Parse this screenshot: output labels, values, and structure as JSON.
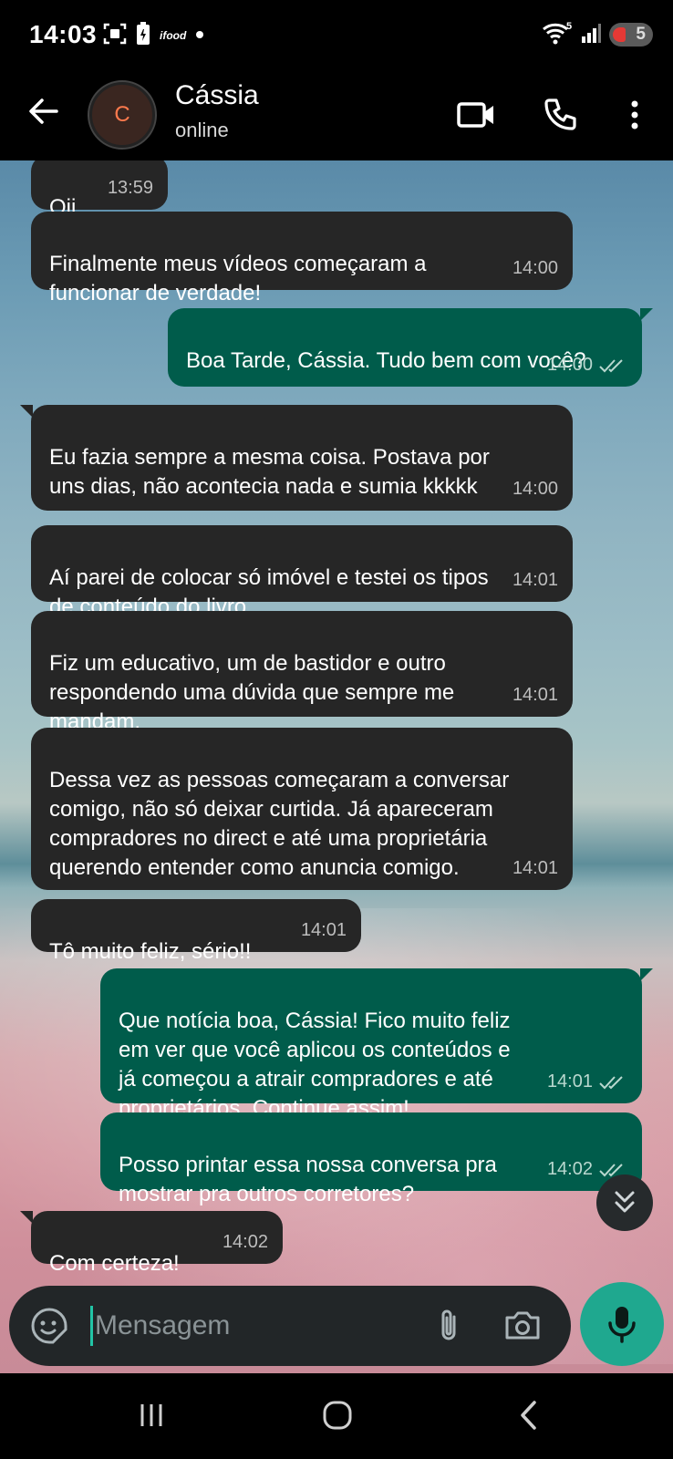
{
  "status_bar": {
    "time": "14:03",
    "app_icon_text": "ifood",
    "signal_badge": "5",
    "battery_level": "5",
    "icons": [
      "screenshot-icon",
      "battery-saver-icon",
      "ifood-icon",
      "dot-icon",
      "wifi-icon",
      "signal-icon",
      "battery-icon"
    ]
  },
  "header": {
    "avatar_initial": "C",
    "name": "Cássia",
    "status": "online",
    "icons": [
      "back-arrow-icon",
      "video-call-icon",
      "voice-call-icon",
      "more-vert-icon"
    ]
  },
  "messages": [
    {
      "dir": "in",
      "text": "Oii",
      "time": "13:59"
    },
    {
      "dir": "in",
      "text": "Finalmente meus vídeos começaram a\nfuncionar de verdade!",
      "time": "14:00"
    },
    {
      "dir": "out",
      "text": "Boa Tarde, Cássia. Tudo bem com você?",
      "time": "14:00"
    },
    {
      "dir": "in",
      "text": "Eu fazia sempre a mesma coisa. Postava por\nuns dias, não acontecia nada e sumia kkkkk",
      "time": "14:00"
    },
    {
      "dir": "in",
      "text": "Aí parei de colocar só imóvel e testei os tipos\nde conteúdo do livro.",
      "time": "14:01"
    },
    {
      "dir": "in",
      "text": "Fiz um educativo, um de bastidor e outro\nrespondendo uma dúvida que sempre me\nmandam.",
      "time": "14:01"
    },
    {
      "dir": "in",
      "text": "Dessa vez as pessoas começaram a conversar\ncomigo, não só deixar curtida. Já apareceram\ncompradores no direct e até uma proprietária\nquerendo entender como anuncia comigo.",
      "time": "14:01"
    },
    {
      "dir": "in",
      "text": "Tô muito feliz, sério!!",
      "time": "14:01"
    },
    {
      "dir": "out",
      "text": "Que notícia boa, Cássia! Fico muito feliz\nem ver que você aplicou os conteúdos e\njá começou a atrair compradores e até\nproprietários. Continue assim!",
      "time": "14:01"
    },
    {
      "dir": "out",
      "text": "Posso printar essa nossa conversa pra\nmostrar pra outros corretores?",
      "time": "14:02"
    },
    {
      "dir": "in",
      "text": "Com certeza!",
      "time": "14:02"
    }
  ],
  "composer": {
    "placeholder": "Mensagem",
    "icons": [
      "sticker-icon",
      "attach-icon",
      "camera-icon",
      "mic-icon"
    ]
  },
  "nav": {
    "icons": [
      "recents-icon",
      "home-icon",
      "back-icon"
    ]
  },
  "colors": {
    "incoming_bubble": "#262626",
    "outgoing_bubble": "#005c4b",
    "accent": "#1fa88f"
  }
}
